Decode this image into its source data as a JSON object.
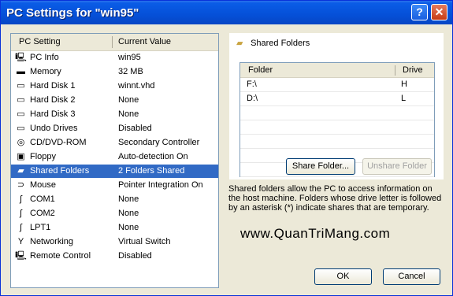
{
  "window": {
    "title": "PC Settings for \"win95\"",
    "help_label": "?",
    "close_label": "✕"
  },
  "settings": {
    "header_setting": "PC Setting",
    "header_value": "Current Value",
    "rows": [
      {
        "name": "PC Info",
        "value": "win95",
        "icon": "pc-icon",
        "glyph": "🖳"
      },
      {
        "name": "Memory",
        "value": "32 MB",
        "icon": "memory-icon",
        "glyph": "▬"
      },
      {
        "name": "Hard Disk 1",
        "value": "winnt.vhd",
        "icon": "hard-disk-icon",
        "glyph": "▭"
      },
      {
        "name": "Hard Disk 2",
        "value": "None",
        "icon": "hard-disk-icon",
        "glyph": "▭"
      },
      {
        "name": "Hard Disk 3",
        "value": "None",
        "icon": "hard-disk-icon",
        "glyph": "▭"
      },
      {
        "name": "Undo Drives",
        "value": "Disabled",
        "icon": "undo-drive-icon",
        "glyph": "▭"
      },
      {
        "name": "CD/DVD-ROM",
        "value": "Secondary Controller",
        "icon": "cd-icon",
        "glyph": "◎"
      },
      {
        "name": "Floppy",
        "value": "Auto-detection On",
        "icon": "floppy-icon",
        "glyph": "▣"
      },
      {
        "name": "Shared Folders",
        "value": "2 Folders Shared",
        "icon": "folder-icon",
        "glyph": "▰"
      },
      {
        "name": "Mouse",
        "value": "Pointer Integration On",
        "icon": "mouse-icon",
        "glyph": "⊃"
      },
      {
        "name": "COM1",
        "value": "None",
        "icon": "com-port-icon",
        "glyph": "ʃ"
      },
      {
        "name": "COM2",
        "value": "None",
        "icon": "com-port-icon",
        "glyph": "ʃ"
      },
      {
        "name": "LPT1",
        "value": "None",
        "icon": "lpt-port-icon",
        "glyph": "ʃ"
      },
      {
        "name": "Networking",
        "value": "Virtual Switch",
        "icon": "network-icon",
        "glyph": "Y"
      },
      {
        "name": "Remote Control",
        "value": "Disabled",
        "icon": "remote-control-icon",
        "glyph": "🖳"
      }
    ],
    "selected_index": 8
  },
  "shared_folders": {
    "title": "Shared Folders",
    "col_folder": "Folder",
    "col_drive": "Drive",
    "rows": [
      {
        "folder": "F:\\",
        "drive": "H"
      },
      {
        "folder": "D:\\",
        "drive": "L"
      },
      {
        "folder": "",
        "drive": ""
      },
      {
        "folder": "",
        "drive": ""
      },
      {
        "folder": "",
        "drive": ""
      },
      {
        "folder": "",
        "drive": ""
      },
      {
        "folder": "",
        "drive": ""
      }
    ],
    "share_button": "Share Folder...",
    "unshare_button": "Unshare Folder"
  },
  "description": "Shared folders allow the PC to access information on the host machine. Folders whose drive letter is followed by an asterisk (*) indicate shares that are temporary.",
  "watermark": "www.QuanTriMang.com",
  "footer": {
    "ok_label": "OK",
    "cancel_label": "Cancel"
  }
}
